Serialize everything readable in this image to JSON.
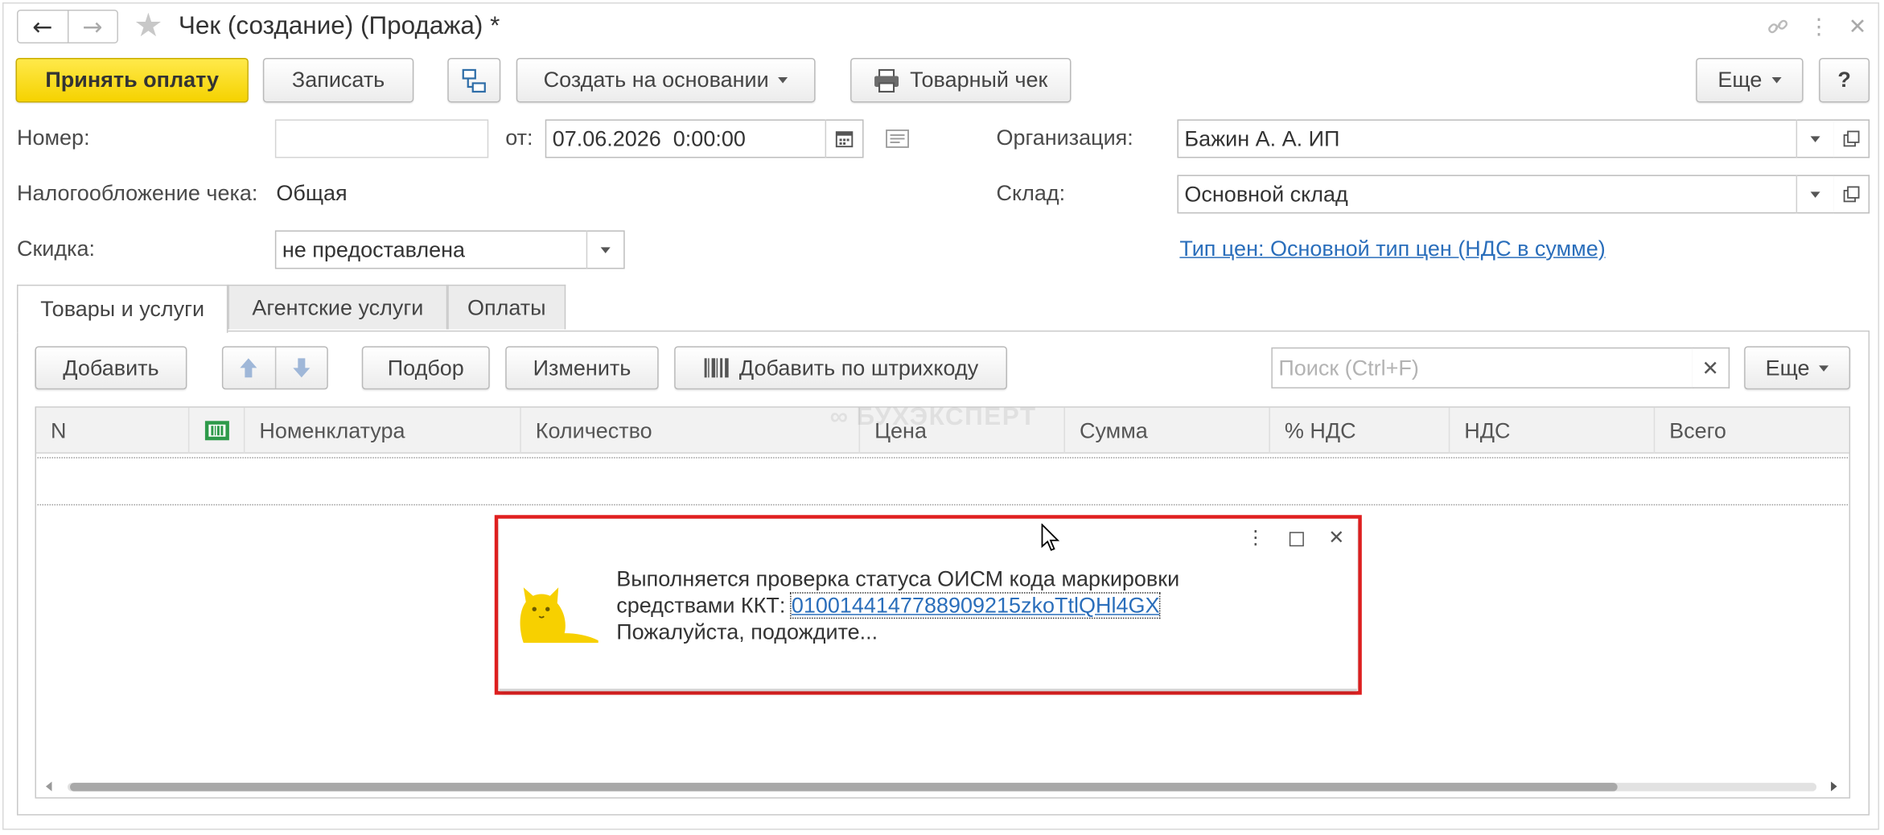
{
  "titlebar": {
    "title": "Чек (создание) (Продажа) *",
    "back_icon": "arrow-left-icon",
    "forward_icon": "arrow-right-icon",
    "favorite_icon": "star-icon",
    "link_icon": "link-icon",
    "more_icon": "more-vertical-icon",
    "close_icon": "close-icon"
  },
  "toolbar": {
    "accept_payment": "Принять оплату",
    "save": "Записать",
    "structure_icon": "document-structure-icon",
    "create_based_on": "Создать на основании",
    "product_receipt": "Товарный чек",
    "printer_icon": "printer-icon",
    "more": "Еще",
    "help": "?"
  },
  "form": {
    "number_label": "Номер:",
    "number_value": "",
    "date_from_label": "от:",
    "date_value": "07.06.2026  0:00:00",
    "organization_label": "Организация:",
    "organization_value": "Бажин А. А. ИП",
    "taxation_label": "Налогообложение чека:",
    "taxation_value": "Общая",
    "warehouse_label": "Склад:",
    "warehouse_value": "Основной склад",
    "discount_label": "Скидка:",
    "discount_value": "не предоставлена",
    "price_type_link": "Тип цен: Основной тип цен (НДС в сумме)"
  },
  "tabs": [
    {
      "label": "Товары и услуги",
      "active": true
    },
    {
      "label": "Агентские услуги",
      "active": false
    },
    {
      "label": "Оплаты",
      "active": false
    }
  ],
  "table_toolbar": {
    "add": "Добавить",
    "up_icon": "arrow-up-icon",
    "down_icon": "arrow-down-icon",
    "selection": "Подбор",
    "edit": "Изменить",
    "add_by_barcode": "Добавить по штрихкоду",
    "barcode_icon": "barcode-icon",
    "search_placeholder": "Поиск (Ctrl+F)",
    "clear_icon": "clear-icon",
    "more": "Еще"
  },
  "table": {
    "columns": [
      "N",
      "",
      "Номенклатура",
      "Количество",
      "Цена",
      "Сумма",
      "% НДС",
      "НДС",
      "Всего"
    ],
    "marking_icon": "marking-code-icon",
    "rows": []
  },
  "watermark": "БУХЭКСПЕРТ",
  "popup": {
    "line1": "Выполняется проверка статуса ОИСМ кода маркировки",
    "line2_prefix": "средствами ККТ: ",
    "code": "0100144147788909215zkoTtlQHl4GX",
    "line3": "Пожалуйста, подождите...",
    "cat_icon": "waiting-cat-icon",
    "more_icon": "more-vertical-icon",
    "maximize_icon": "maximize-icon",
    "close_icon": "close-icon",
    "highlight_color": "#e02020"
  },
  "colors": {
    "primary_button": "#f5d200",
    "link": "#2a6ebb"
  }
}
